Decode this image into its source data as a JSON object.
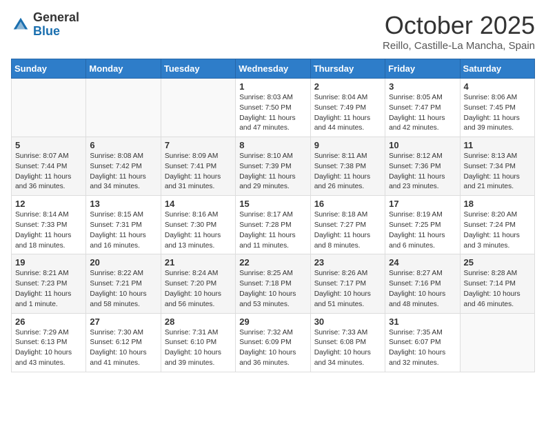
{
  "header": {
    "logo_general": "General",
    "logo_blue": "Blue",
    "month_title": "October 2025",
    "location": "Reillo, Castille-La Mancha, Spain"
  },
  "weekdays": [
    "Sunday",
    "Monday",
    "Tuesday",
    "Wednesday",
    "Thursday",
    "Friday",
    "Saturday"
  ],
  "weeks": [
    [
      {
        "day": "",
        "info": ""
      },
      {
        "day": "",
        "info": ""
      },
      {
        "day": "",
        "info": ""
      },
      {
        "day": "1",
        "info": "Sunrise: 8:03 AM\nSunset: 7:50 PM\nDaylight: 11 hours and 47 minutes."
      },
      {
        "day": "2",
        "info": "Sunrise: 8:04 AM\nSunset: 7:49 PM\nDaylight: 11 hours and 44 minutes."
      },
      {
        "day": "3",
        "info": "Sunrise: 8:05 AM\nSunset: 7:47 PM\nDaylight: 11 hours and 42 minutes."
      },
      {
        "day": "4",
        "info": "Sunrise: 8:06 AM\nSunset: 7:45 PM\nDaylight: 11 hours and 39 minutes."
      }
    ],
    [
      {
        "day": "5",
        "info": "Sunrise: 8:07 AM\nSunset: 7:44 PM\nDaylight: 11 hours and 36 minutes."
      },
      {
        "day": "6",
        "info": "Sunrise: 8:08 AM\nSunset: 7:42 PM\nDaylight: 11 hours and 34 minutes."
      },
      {
        "day": "7",
        "info": "Sunrise: 8:09 AM\nSunset: 7:41 PM\nDaylight: 11 hours and 31 minutes."
      },
      {
        "day": "8",
        "info": "Sunrise: 8:10 AM\nSunset: 7:39 PM\nDaylight: 11 hours and 29 minutes."
      },
      {
        "day": "9",
        "info": "Sunrise: 8:11 AM\nSunset: 7:38 PM\nDaylight: 11 hours and 26 minutes."
      },
      {
        "day": "10",
        "info": "Sunrise: 8:12 AM\nSunset: 7:36 PM\nDaylight: 11 hours and 23 minutes."
      },
      {
        "day": "11",
        "info": "Sunrise: 8:13 AM\nSunset: 7:34 PM\nDaylight: 11 hours and 21 minutes."
      }
    ],
    [
      {
        "day": "12",
        "info": "Sunrise: 8:14 AM\nSunset: 7:33 PM\nDaylight: 11 hours and 18 minutes."
      },
      {
        "day": "13",
        "info": "Sunrise: 8:15 AM\nSunset: 7:31 PM\nDaylight: 11 hours and 16 minutes."
      },
      {
        "day": "14",
        "info": "Sunrise: 8:16 AM\nSunset: 7:30 PM\nDaylight: 11 hours and 13 minutes."
      },
      {
        "day": "15",
        "info": "Sunrise: 8:17 AM\nSunset: 7:28 PM\nDaylight: 11 hours and 11 minutes."
      },
      {
        "day": "16",
        "info": "Sunrise: 8:18 AM\nSunset: 7:27 PM\nDaylight: 11 hours and 8 minutes."
      },
      {
        "day": "17",
        "info": "Sunrise: 8:19 AM\nSunset: 7:25 PM\nDaylight: 11 hours and 6 minutes."
      },
      {
        "day": "18",
        "info": "Sunrise: 8:20 AM\nSunset: 7:24 PM\nDaylight: 11 hours and 3 minutes."
      }
    ],
    [
      {
        "day": "19",
        "info": "Sunrise: 8:21 AM\nSunset: 7:23 PM\nDaylight: 11 hours and 1 minute."
      },
      {
        "day": "20",
        "info": "Sunrise: 8:22 AM\nSunset: 7:21 PM\nDaylight: 10 hours and 58 minutes."
      },
      {
        "day": "21",
        "info": "Sunrise: 8:24 AM\nSunset: 7:20 PM\nDaylight: 10 hours and 56 minutes."
      },
      {
        "day": "22",
        "info": "Sunrise: 8:25 AM\nSunset: 7:18 PM\nDaylight: 10 hours and 53 minutes."
      },
      {
        "day": "23",
        "info": "Sunrise: 8:26 AM\nSunset: 7:17 PM\nDaylight: 10 hours and 51 minutes."
      },
      {
        "day": "24",
        "info": "Sunrise: 8:27 AM\nSunset: 7:16 PM\nDaylight: 10 hours and 48 minutes."
      },
      {
        "day": "25",
        "info": "Sunrise: 8:28 AM\nSunset: 7:14 PM\nDaylight: 10 hours and 46 minutes."
      }
    ],
    [
      {
        "day": "26",
        "info": "Sunrise: 7:29 AM\nSunset: 6:13 PM\nDaylight: 10 hours and 43 minutes."
      },
      {
        "day": "27",
        "info": "Sunrise: 7:30 AM\nSunset: 6:12 PM\nDaylight: 10 hours and 41 minutes."
      },
      {
        "day": "28",
        "info": "Sunrise: 7:31 AM\nSunset: 6:10 PM\nDaylight: 10 hours and 39 minutes."
      },
      {
        "day": "29",
        "info": "Sunrise: 7:32 AM\nSunset: 6:09 PM\nDaylight: 10 hours and 36 minutes."
      },
      {
        "day": "30",
        "info": "Sunrise: 7:33 AM\nSunset: 6:08 PM\nDaylight: 10 hours and 34 minutes."
      },
      {
        "day": "31",
        "info": "Sunrise: 7:35 AM\nSunset: 6:07 PM\nDaylight: 10 hours and 32 minutes."
      },
      {
        "day": "",
        "info": ""
      }
    ]
  ]
}
